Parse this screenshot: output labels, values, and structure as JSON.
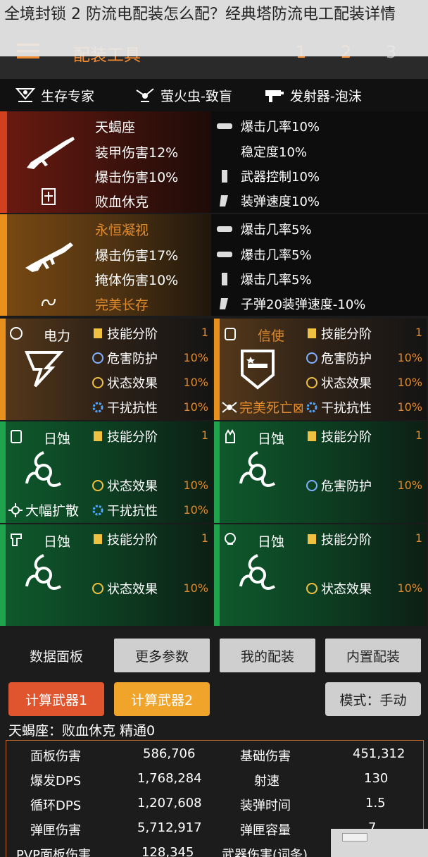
{
  "overlay_title": "全境封锁 2 防流电配装怎么配？经典塔防流电工配装详情",
  "header": {
    "title": "配装工具",
    "pages": [
      "1",
      "2",
      "3"
    ]
  },
  "talents": [
    {
      "label": "生存专家",
      "icon": "skull-crossbones-icon"
    },
    {
      "label": "萤火虫-致盲",
      "icon": "firefly-drone-icon"
    },
    {
      "label": "发射器-泡沫",
      "icon": "launcher-icon"
    }
  ],
  "weapons": [
    {
      "name": "天蝎座",
      "attrs": [
        "装甲伤害12%",
        "爆击伤害10%",
        "败血休克"
      ],
      "mods": [
        "爆击几率10%",
        "稳定度10%",
        "武器控制10%",
        "装弹速度10%"
      ]
    },
    {
      "name": "永恒凝视",
      "attrs": [
        "爆击伤害17%",
        "掩体伤害10%",
        "完美长存"
      ],
      "mods": [
        "爆击几率5%",
        "爆击几率5%",
        "爆击几率5%",
        "子弹20装弹速度-10%"
      ]
    }
  ],
  "gear": [
    {
      "name": "电力",
      "rows": [
        [
          "技能分阶",
          "1"
        ],
        [
          "危害防护",
          "10%"
        ],
        [
          "状态效果",
          "10%"
        ],
        [
          "干扰抗性",
          "10%"
        ]
      ],
      "bottom": ""
    },
    {
      "name": "信使",
      "rows": [
        [
          "技能分阶",
          "1"
        ],
        [
          "危害防护",
          "10%"
        ],
        [
          "状态效果",
          "10%"
        ],
        [
          "干扰抗性",
          "10%"
        ]
      ],
      "bottom": "完美死亡⊠"
    },
    {
      "name": "日蚀",
      "rows": [
        [
          "技能分阶",
          "1"
        ],
        [
          "状态效果",
          "10%"
        ],
        [
          "干扰抗性",
          "10%"
        ]
      ],
      "bottom": "大幅扩散"
    },
    {
      "name": "日蚀",
      "rows": [
        [
          "技能分阶",
          "1"
        ],
        [
          "危害防护",
          "10%"
        ]
      ],
      "bottom": ""
    },
    {
      "name": "日蚀",
      "rows": [
        [
          "技能分阶",
          "1"
        ],
        [
          "状态效果",
          "10%"
        ]
      ],
      "bottom": ""
    },
    {
      "name": "日蚀",
      "rows": [
        [
          "技能分阶",
          "1"
        ],
        [
          "状态效果",
          "10%"
        ]
      ],
      "bottom": ""
    }
  ],
  "buttons": {
    "data_panel": "数据面板",
    "more_params": "更多参数",
    "my_builds": "我的配装",
    "builtin_builds": "内置配装",
    "calc_weapon1": "计算武器1",
    "calc_weapon2": "计算武器2",
    "mode": "模式：手动"
  },
  "summary": "天蝎座：败血休克    精通0",
  "stats": [
    [
      "面板伤害",
      "586,706",
      "基础伤害",
      "451,312"
    ],
    [
      "爆发DPS",
      "1,768,284",
      "射速",
      "130"
    ],
    [
      "循环DPS",
      "1,207,608",
      "装弹时间",
      "1.5"
    ],
    [
      "弹匣伤害",
      "5,712,917",
      "弹匣容量",
      "7"
    ],
    [
      "PVP面板伤害",
      "128,345",
      "武器伤害(词条)",
      ""
    ]
  ],
  "colors": {
    "accent": "#f08a30",
    "red": "#d2401e",
    "green": "#1fa34d",
    "value": "#e08a2e"
  }
}
